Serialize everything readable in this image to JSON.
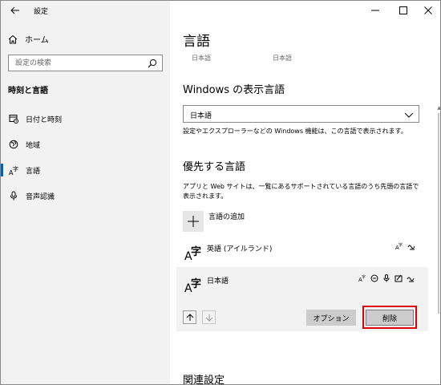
{
  "window": {
    "app_title": "設定",
    "controls": {
      "minimize": "minimize",
      "maximize": "maximize",
      "close": "close"
    }
  },
  "sidebar": {
    "home_label": "ホーム",
    "search_placeholder": "設定の検索",
    "section_title": "時刻と言語",
    "items": [
      {
        "label": "日付と時刻",
        "icon": "calendar-clock-icon",
        "selected": false
      },
      {
        "label": "地域",
        "icon": "globe-region-icon",
        "selected": false
      },
      {
        "label": "言語",
        "icon": "language-icon",
        "selected": true
      },
      {
        "label": "音声認識",
        "icon": "microphone-icon",
        "selected": false
      }
    ]
  },
  "main": {
    "title": "言語",
    "sub_left": "日本語",
    "sub_right": "日本語",
    "display_language": {
      "heading": "Windows の表示言語",
      "selected": "日本語",
      "description": "設定やエクスプローラーなどの Windows 機能は、この言語で表示されます。"
    },
    "preferred": {
      "heading": "優先する言語",
      "description": "アプリと Web サイトは、一覧にあるサポートされている言語のうち先頭の言語で表示されます。",
      "add_label": "言語の追加",
      "languages": [
        {
          "name": "英語 (アイルランド)",
          "glyph_a": "A",
          "glyph_ji": "字",
          "features": [
            "display-language-icon",
            "handwriting-icon"
          ]
        },
        {
          "name": "日本語",
          "glyph_a": "A",
          "glyph_ji": "字",
          "features": [
            "display-language-icon",
            "text-to-speech-icon",
            "speech-recognition-icon",
            "handwriting-icon",
            "keyboard-icon"
          ]
        }
      ],
      "options_label": "オプション",
      "remove_label": "削除"
    },
    "related_heading": "関連設定"
  },
  "colors": {
    "accent": "#0063b1",
    "highlight": "#e00000",
    "sidebar_bg": "#f2f2f2",
    "selected_row_bg": "#f2f2f2"
  }
}
